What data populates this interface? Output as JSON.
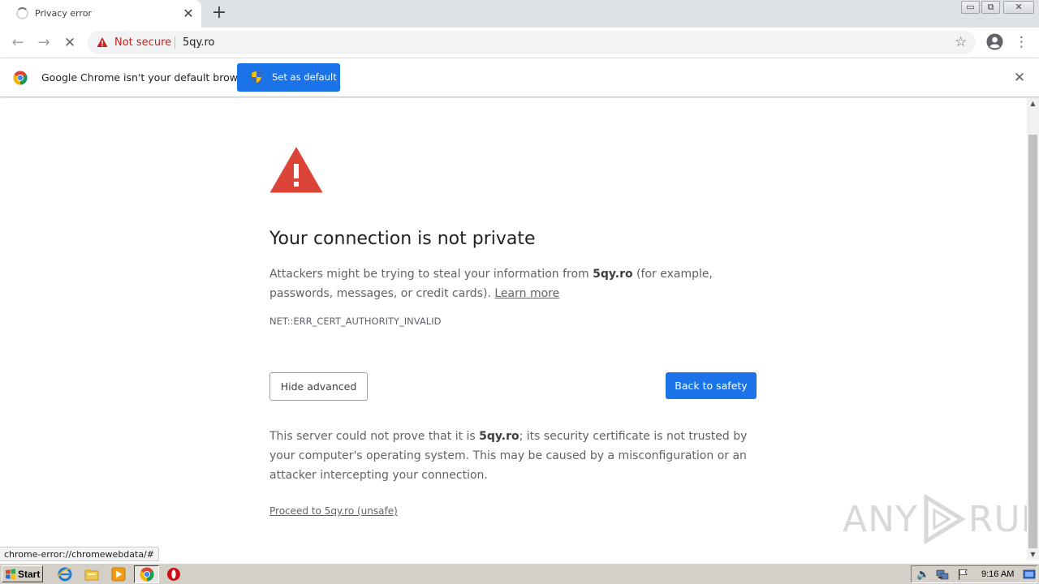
{
  "tab": {
    "title": "Privacy error",
    "close": "✕",
    "new_tab": "+"
  },
  "window_controls": {
    "minimize": "▭",
    "maximize": "⧉",
    "close": "✕"
  },
  "toolbar": {
    "security_label": "Not secure",
    "url": "5qy.ro",
    "icons": [
      "back-arrow-icon",
      "forward-arrow-icon",
      "stop-icon",
      "warning-icon",
      "star-icon",
      "profile-icon",
      "menu-icon"
    ]
  },
  "infobar": {
    "message": "Google Chrome isn't your default browser",
    "button_label": "Set as default",
    "close": "✕"
  },
  "page": {
    "heading": "Your connection is not private",
    "explanation_prefix": "Attackers might be trying to steal your information from ",
    "explanation_host": "5qy.ro",
    "explanation_suffix": " (for example, passwords, messages, or credit cards). ",
    "learn_more": "Learn more",
    "error_code": "NET::ERR_CERT_AUTHORITY_INVALID",
    "hide_advanced": "Hide advanced",
    "back_to_safety": "Back to safety",
    "details_prefix": "This server could not prove that it is ",
    "details_host": "5qy.ro",
    "details_suffix": "; its security certificate is not trusted by your computer's operating system. This may be caused by a misconfiguration or an attacker intercepting your connection.",
    "proceed_link": "Proceed to 5qy.ro (unsafe)"
  },
  "watermark": {
    "left": "ANY",
    "right": "RUN"
  },
  "status_bubble": "chrome-error://chromewebdata/#",
  "taskbar": {
    "start_label": "Start",
    "clock": "9:16 AM"
  },
  "colors": {
    "accent": "#1a73e8",
    "danger": "#c5221f",
    "warning_triangle": "#db4437"
  }
}
